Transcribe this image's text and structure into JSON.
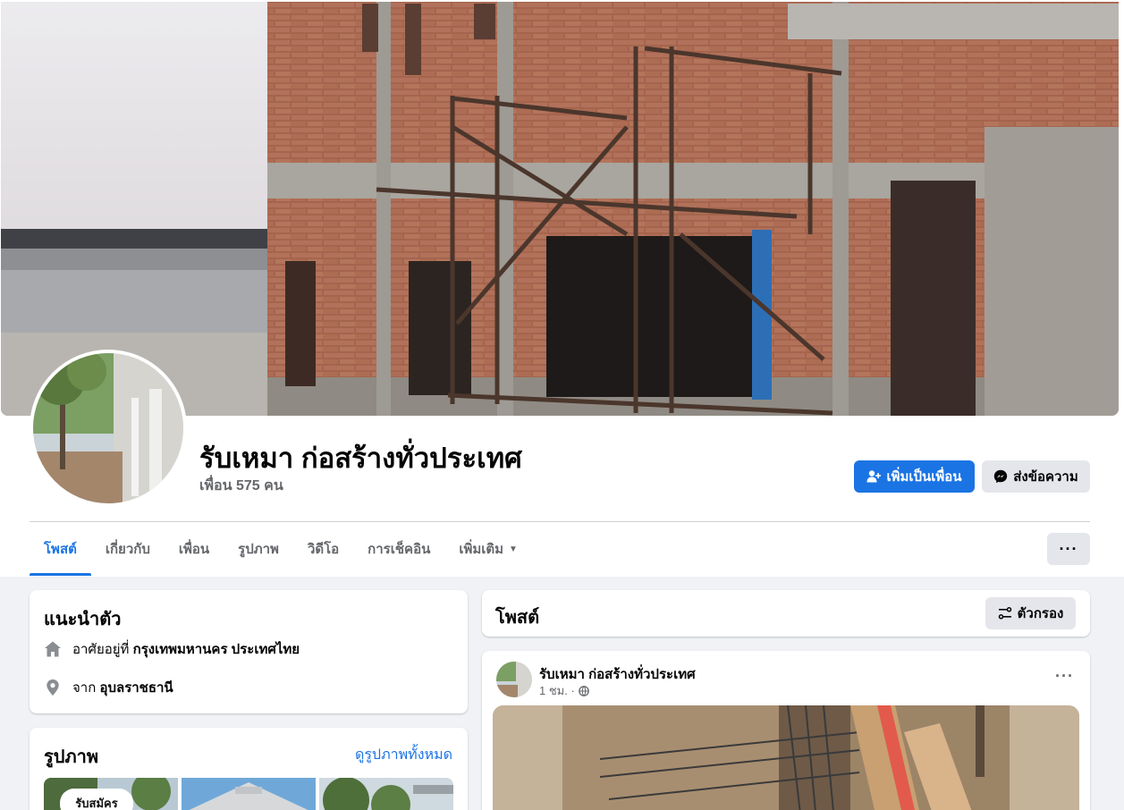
{
  "profile": {
    "name": "รับเหมา ก่อสร้างทั่วประเทศ",
    "friends": "เพื่อน 575 คน",
    "add_friend_label": "เพิ่มเป็นเพื่อน",
    "message_label": "ส่งข้อความ"
  },
  "tabs": [
    {
      "label": "โพสต์"
    },
    {
      "label": "เกี่ยวกับ"
    },
    {
      "label": "เพื่อน"
    },
    {
      "label": "รูปภาพ"
    },
    {
      "label": "วิดีโอ"
    },
    {
      "label": "การเช็คอิน"
    },
    {
      "label": "เพิ่มเติม"
    }
  ],
  "more_options": "···",
  "intro": {
    "title": "แนะนำตัว",
    "lives_prefix": "อาศัยอยู่ที่",
    "lives_value": "กรุงเทพมหานคร ประเทศไทย",
    "from_prefix": "จาก",
    "from_value": "อุบลราชธานี"
  },
  "photos": {
    "title": "รูปภาพ",
    "see_all": "ดูรูปภาพทั้งหมด",
    "thumb_caption": "รับสมัคร"
  },
  "posts": {
    "title": "โพสต์",
    "filter_label": "ตัวกรอง"
  },
  "post": {
    "author": "รับเหมา ก่อสร้างทั่วประเทศ",
    "time": "1 ชม. ·",
    "more": "···"
  },
  "colors": {
    "accent": "#1b74e4",
    "secondary_button": "#e4e6eb",
    "background": "#f0f2f5",
    "muted_text": "#65676b"
  },
  "icons": {
    "add_friend": "person-plus-icon",
    "message": "messenger-icon",
    "home": "home-icon",
    "location": "location-pin-icon",
    "filter": "filter-icon",
    "globe": "globe-icon",
    "dropdown": "caret-down-icon"
  }
}
